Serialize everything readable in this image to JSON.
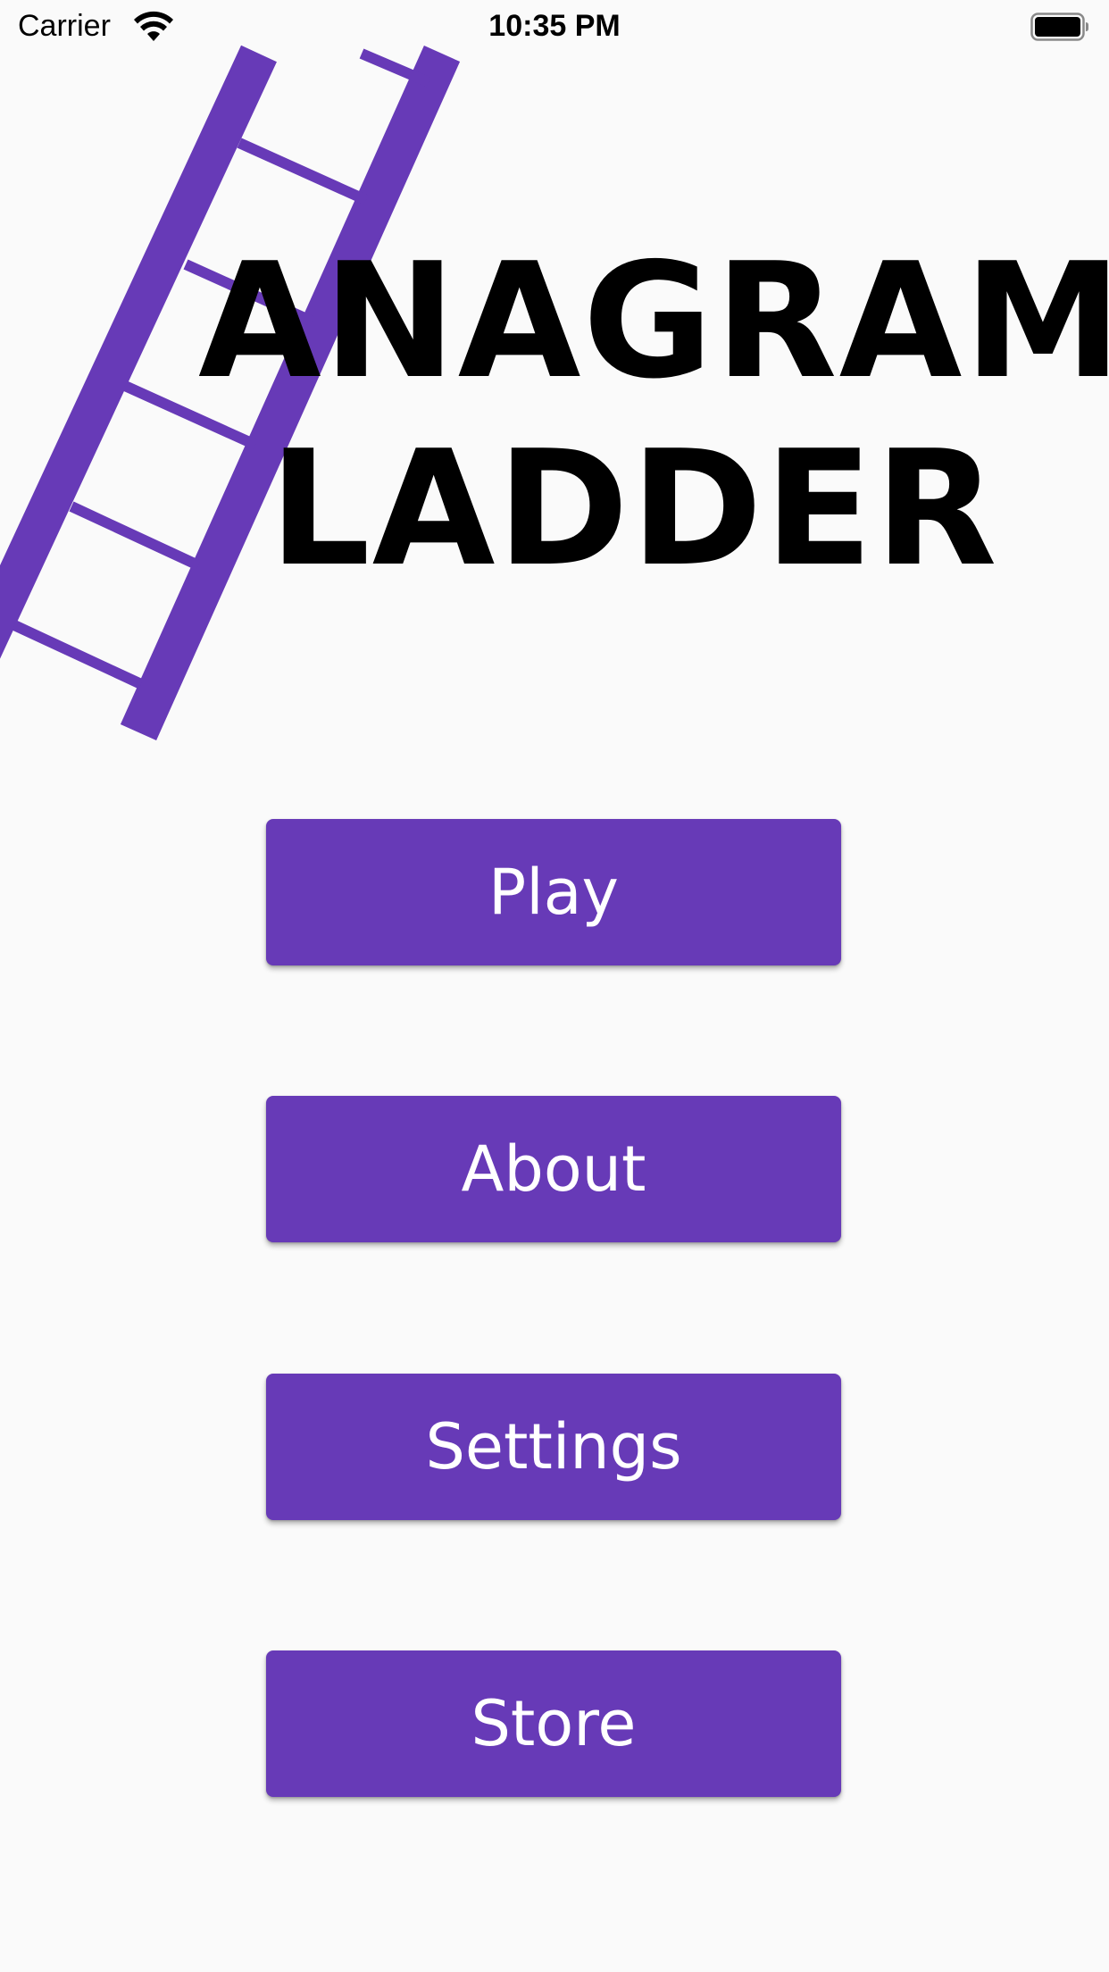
{
  "status_bar": {
    "carrier": "Carrier",
    "time": "10:35 PM",
    "icons": [
      "wifi-icon",
      "battery-icon"
    ]
  },
  "title": {
    "line1": "ANAGRAM",
    "line2": "LADDER"
  },
  "menu": {
    "play_label": "Play",
    "about_label": "About",
    "settings_label": "Settings",
    "store_label": "Store"
  },
  "colors": {
    "accent": "#673ab7",
    "background": "#fafafa",
    "title_text": "#000000",
    "button_text": "#ffffff"
  },
  "decoration": {
    "illustration": "ladder-illustration"
  }
}
